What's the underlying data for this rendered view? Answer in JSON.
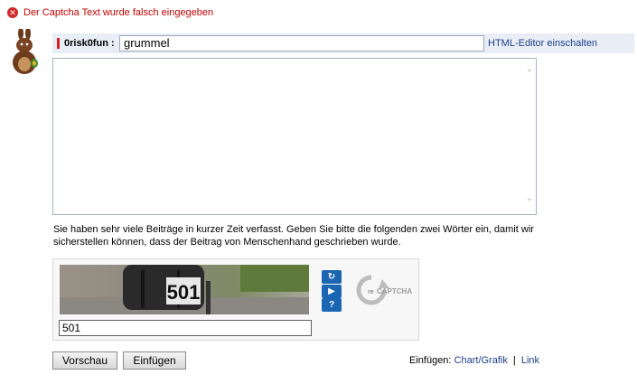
{
  "error": {
    "message": "Der Captcha Text wurde falsch eingegeben",
    "icon": "error-circle-icon",
    "color": "#c00000"
  },
  "header": {
    "username": "0risk0fun :",
    "title_value": "grummel",
    "html_editor_label": "HTML-Editor einschalten"
  },
  "editor": {
    "message_value": ""
  },
  "notice": {
    "text": "Sie haben sehr viele Beiträge in kurzer Zeit verfasst. Geben Sie bitte die folgenden zwei Wörter ein, damit wir sicherstellen können, dass der Beitrag von Menschenhand geschrieben wurde."
  },
  "captcha": {
    "image_text": "501",
    "input_value": "501",
    "buttons": [
      "refresh-icon",
      "audio-icon",
      "help-icon"
    ]
  },
  "actions": {
    "preview_label": "Vorschau",
    "insert_label": "Einfügen"
  },
  "insert_links": {
    "label": "Einfügen:",
    "chart_label": "Chart/Grafik",
    "separator": "|",
    "link_label": "Link"
  },
  "colors": {
    "accent_link": "#1a3e8c",
    "header_bg": "#e9eef6",
    "captcha_button": "#1b66b3"
  }
}
